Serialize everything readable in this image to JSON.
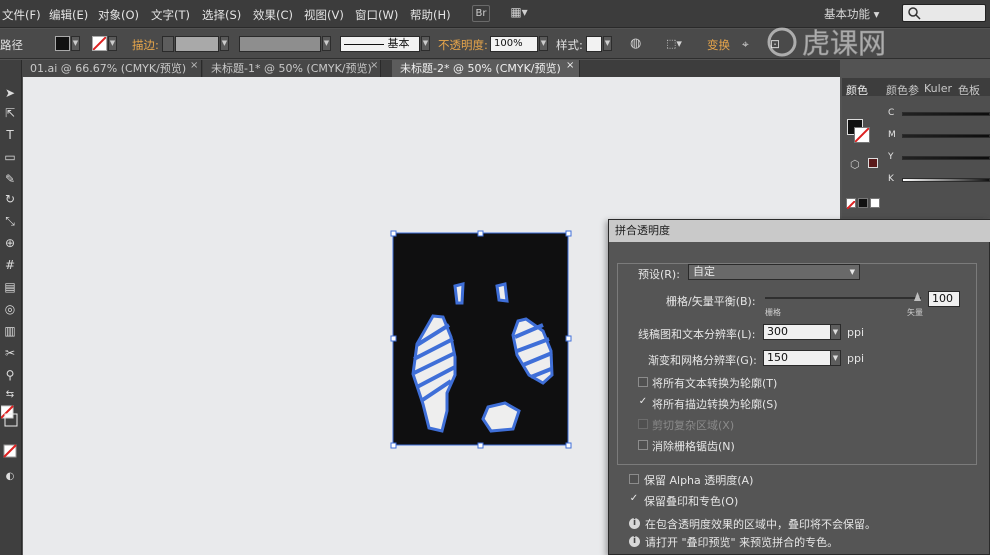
{
  "menubar": {
    "items": [
      "文件(F)",
      "编辑(E)",
      "对象(O)",
      "文字(T)",
      "选择(S)",
      "效果(C)",
      "视图(V)",
      "窗口(W)",
      "帮助(H)"
    ],
    "bridge_btn": "Br",
    "arrange_btn": "▦▾",
    "workspace": "基本功能",
    "workspace_arrow": "▾"
  },
  "controlbar": {
    "path_label": "路径",
    "stroke_label": "描边:",
    "brush_label": "基本",
    "opacity_label": "不透明度:",
    "opacity_value": "100%",
    "style_label": "样式:",
    "transform_label": "变换"
  },
  "tabs": [
    {
      "label": "01.ai @ 66.67% (CMYK/预览)",
      "close": "×"
    },
    {
      "label": "未标题-1* @ 50% (CMYK/预览)",
      "close": "×"
    },
    {
      "label": "未标题-2* @ 50% (CMYK/预览)",
      "close": "×"
    }
  ],
  "color_panel": {
    "tabs": [
      "颜色",
      "颜色参",
      "Kuler",
      "色板"
    ],
    "channels": [
      "C",
      "M",
      "Y",
      "K"
    ]
  },
  "dialog": {
    "title": "拼合透明度",
    "preset_label": "预设(R):",
    "preset_value": "自定",
    "balance_label": "栅格/矢量平衡(B):",
    "balance_value": "100",
    "balance_min_label": "栅格",
    "balance_max_label": "矢量",
    "line_res_label": "线稿图和文本分辨率(L):",
    "line_res_value": "300",
    "line_res_unit": "ppi",
    "grad_res_label": "渐变和网格分辨率(G):",
    "grad_res_value": "150",
    "grad_res_unit": "ppi",
    "options": [
      {
        "label": "将所有文本转换为轮廓(T)",
        "checked": false,
        "disabled": false
      },
      {
        "label": "将所有描边转换为轮廓(S)",
        "checked": true,
        "disabled": false
      },
      {
        "label": "剪切复杂区域(X)",
        "checked": false,
        "disabled": true
      },
      {
        "label": "消除栅格锯齿(N)",
        "checked": false,
        "disabled": false
      }
    ],
    "preserve_alpha_label": "保留 Alpha 透明度(A)",
    "preserve_alpha_checked": false,
    "preserve_overprint_label": "保留叠印和专色(O)",
    "preserve_overprint_checked": true,
    "info_1": "在包含透明度效果的区域中，叠印将不会保留。",
    "info_2": "请打开 \"叠印预览\" 来预览拼合的专色。",
    "check_mark": "✓",
    "info_glyph": "i",
    "arrow_glyph": "▼"
  },
  "watermark": "虎课网",
  "colors": {
    "accent_orange": "#e8a64a",
    "selection_blue": "#3f6fd8",
    "artboard_black": "#0f0f10"
  }
}
